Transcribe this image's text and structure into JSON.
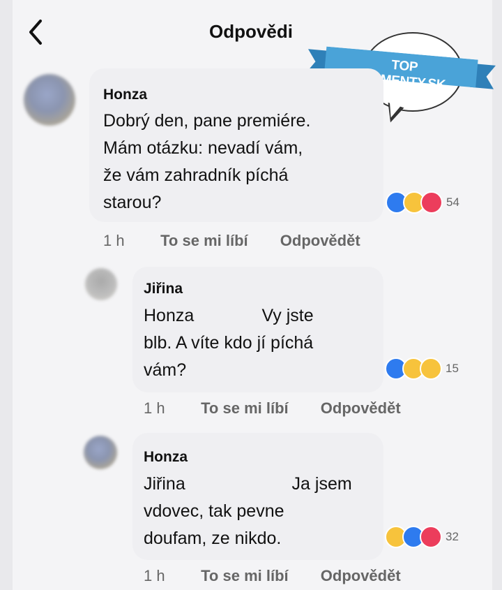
{
  "header": {
    "title": "Odpovědi"
  },
  "watermark": {
    "text": "TOP KOMENTY.SK"
  },
  "comments": [
    {
      "author": "Honza",
      "lines": [
        "Dobrý den, pane premiére.",
        "Mám otázku: nevadí vám,",
        "že vám zahradník píchá",
        "starou?"
      ],
      "reactions": [
        "like-icon",
        "haha-icon",
        "love-icon"
      ],
      "reaction_count": "54",
      "time": "1 h",
      "like_label": "To se mi líbí",
      "reply_label": "Odpovědět"
    },
    {
      "author": "Jiřina",
      "lines": [
        "Honza              Vy jste",
        "blb. A víte kdo jí píchá",
        "vám?"
      ],
      "reactions": [
        "like-icon",
        "haha-icon",
        "sad-icon"
      ],
      "reaction_count": "15",
      "time": "1 h",
      "like_label": "To se mi líbí",
      "reply_label": "Odpovědět"
    },
    {
      "author": "Honza",
      "lines": [
        "Jiřina                      Ja jsem",
        "vdovec, tak pevne",
        "doufam, ze nikdo."
      ],
      "reactions": [
        "haha-icon",
        "like-icon",
        "love-icon"
      ],
      "reaction_count": "32",
      "time": "1 h",
      "like_label": "To se mi líbí",
      "reply_label": "Odpovědět"
    }
  ],
  "colors": {
    "like": "#2e7bef",
    "haha": "#f7c33c",
    "love": "#ec3d5c",
    "ribbon": "#4aa3d8"
  }
}
